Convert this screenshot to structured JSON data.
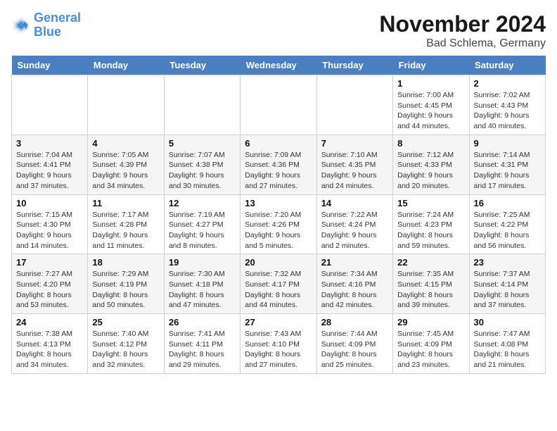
{
  "header": {
    "logo_line1": "General",
    "logo_line2": "Blue",
    "month_title": "November 2024",
    "location": "Bad Schlema, Germany"
  },
  "weekdays": [
    "Sunday",
    "Monday",
    "Tuesday",
    "Wednesday",
    "Thursday",
    "Friday",
    "Saturday"
  ],
  "weeks": [
    [
      {
        "day": "",
        "info": ""
      },
      {
        "day": "",
        "info": ""
      },
      {
        "day": "",
        "info": ""
      },
      {
        "day": "",
        "info": ""
      },
      {
        "day": "",
        "info": ""
      },
      {
        "day": "1",
        "info": "Sunrise: 7:00 AM\nSunset: 4:45 PM\nDaylight: 9 hours\nand 44 minutes."
      },
      {
        "day": "2",
        "info": "Sunrise: 7:02 AM\nSunset: 4:43 PM\nDaylight: 9 hours\nand 40 minutes."
      }
    ],
    [
      {
        "day": "3",
        "info": "Sunrise: 7:04 AM\nSunset: 4:41 PM\nDaylight: 9 hours\nand 37 minutes."
      },
      {
        "day": "4",
        "info": "Sunrise: 7:05 AM\nSunset: 4:39 PM\nDaylight: 9 hours\nand 34 minutes."
      },
      {
        "day": "5",
        "info": "Sunrise: 7:07 AM\nSunset: 4:38 PM\nDaylight: 9 hours\nand 30 minutes."
      },
      {
        "day": "6",
        "info": "Sunrise: 7:09 AM\nSunset: 4:36 PM\nDaylight: 9 hours\nand 27 minutes."
      },
      {
        "day": "7",
        "info": "Sunrise: 7:10 AM\nSunset: 4:35 PM\nDaylight: 9 hours\nand 24 minutes."
      },
      {
        "day": "8",
        "info": "Sunrise: 7:12 AM\nSunset: 4:33 PM\nDaylight: 9 hours\nand 20 minutes."
      },
      {
        "day": "9",
        "info": "Sunrise: 7:14 AM\nSunset: 4:31 PM\nDaylight: 9 hours\nand 17 minutes."
      }
    ],
    [
      {
        "day": "10",
        "info": "Sunrise: 7:15 AM\nSunset: 4:30 PM\nDaylight: 9 hours\nand 14 minutes."
      },
      {
        "day": "11",
        "info": "Sunrise: 7:17 AM\nSunset: 4:28 PM\nDaylight: 9 hours\nand 11 minutes."
      },
      {
        "day": "12",
        "info": "Sunrise: 7:19 AM\nSunset: 4:27 PM\nDaylight: 9 hours\nand 8 minutes."
      },
      {
        "day": "13",
        "info": "Sunrise: 7:20 AM\nSunset: 4:26 PM\nDaylight: 9 hours\nand 5 minutes."
      },
      {
        "day": "14",
        "info": "Sunrise: 7:22 AM\nSunset: 4:24 PM\nDaylight: 9 hours\nand 2 minutes."
      },
      {
        "day": "15",
        "info": "Sunrise: 7:24 AM\nSunset: 4:23 PM\nDaylight: 8 hours\nand 59 minutes."
      },
      {
        "day": "16",
        "info": "Sunrise: 7:25 AM\nSunset: 4:22 PM\nDaylight: 8 hours\nand 56 minutes."
      }
    ],
    [
      {
        "day": "17",
        "info": "Sunrise: 7:27 AM\nSunset: 4:20 PM\nDaylight: 8 hours\nand 53 minutes."
      },
      {
        "day": "18",
        "info": "Sunrise: 7:29 AM\nSunset: 4:19 PM\nDaylight: 8 hours\nand 50 minutes."
      },
      {
        "day": "19",
        "info": "Sunrise: 7:30 AM\nSunset: 4:18 PM\nDaylight: 8 hours\nand 47 minutes."
      },
      {
        "day": "20",
        "info": "Sunrise: 7:32 AM\nSunset: 4:17 PM\nDaylight: 8 hours\nand 44 minutes."
      },
      {
        "day": "21",
        "info": "Sunrise: 7:34 AM\nSunset: 4:16 PM\nDaylight: 8 hours\nand 42 minutes."
      },
      {
        "day": "22",
        "info": "Sunrise: 7:35 AM\nSunset: 4:15 PM\nDaylight: 8 hours\nand 39 minutes."
      },
      {
        "day": "23",
        "info": "Sunrise: 7:37 AM\nSunset: 4:14 PM\nDaylight: 8 hours\nand 37 minutes."
      }
    ],
    [
      {
        "day": "24",
        "info": "Sunrise: 7:38 AM\nSunset: 4:13 PM\nDaylight: 8 hours\nand 34 minutes."
      },
      {
        "day": "25",
        "info": "Sunrise: 7:40 AM\nSunset: 4:12 PM\nDaylight: 8 hours\nand 32 minutes."
      },
      {
        "day": "26",
        "info": "Sunrise: 7:41 AM\nSunset: 4:11 PM\nDaylight: 8 hours\nand 29 minutes."
      },
      {
        "day": "27",
        "info": "Sunrise: 7:43 AM\nSunset: 4:10 PM\nDaylight: 8 hours\nand 27 minutes."
      },
      {
        "day": "28",
        "info": "Sunrise: 7:44 AM\nSunset: 4:09 PM\nDaylight: 8 hours\nand 25 minutes."
      },
      {
        "day": "29",
        "info": "Sunrise: 7:45 AM\nSunset: 4:09 PM\nDaylight: 8 hours\nand 23 minutes."
      },
      {
        "day": "30",
        "info": "Sunrise: 7:47 AM\nSunset: 4:08 PM\nDaylight: 8 hours\nand 21 minutes."
      }
    ]
  ]
}
